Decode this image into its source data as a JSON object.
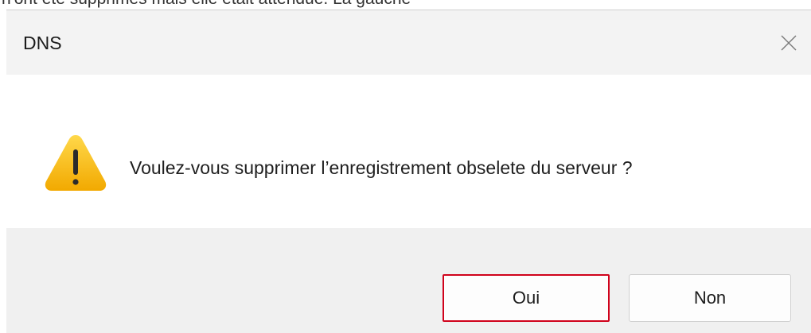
{
  "top_fragment": "n'ont été supprimés mais elle était attendue. La gauche",
  "dialog": {
    "title": "DNS",
    "close_icon": "close-icon",
    "icon": "warning-icon",
    "message": "Voulez-vous supprimer l’enregistrement obselete du serveur ?",
    "buttons": {
      "yes_label": "Oui",
      "no_label": "Non"
    }
  },
  "colors": {
    "titlebar_bg": "#f3f3f3",
    "footer_bg": "#f0f0f0",
    "warning_yellow": "#f4b400",
    "highlight_border": "#d0021b"
  }
}
